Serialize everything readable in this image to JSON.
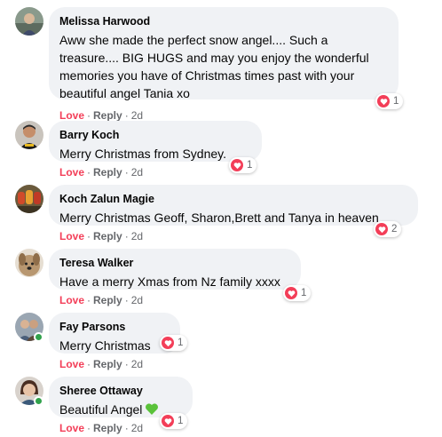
{
  "comments": [
    {
      "author": "Melissa Harwood",
      "lines": [
        "Aww she made the perfect snow angel.... Such a",
        "treasure.... BIG HUGS and may you enjoy the wonderful",
        "memories you have of Christmas times past with your",
        "beautiful angel Tania xo"
      ],
      "reaction_count": "1",
      "love_label": "Love",
      "reply_label": "Reply",
      "time": "2d",
      "avatar_icon": "profile-photo"
    },
    {
      "author": "Barry Koch",
      "text": "Merry Christmas from Sydney.",
      "reaction_count": "1",
      "love_label": "Love",
      "reply_label": "Reply",
      "time": "2d",
      "avatar_icon": "profile-photo"
    },
    {
      "author": "Koch Zalun Magie",
      "text": "Merry Christmas Geoff, Sharon,Brett and Tanya in heaven",
      "reaction_count": "2",
      "love_label": "Love",
      "reply_label": "Reply",
      "time": "2d",
      "avatar_icon": "profile-photo"
    },
    {
      "author": "Teresa Walker",
      "text": "Have a merry Xmas from Nz family xxxx",
      "reaction_count": "1",
      "love_label": "Love",
      "reply_label": "Reply",
      "time": "2d",
      "avatar_icon": "profile-photo"
    },
    {
      "author": "Fay Parsons",
      "text": "Merry Christmas",
      "reaction_count": "1",
      "love_label": "Love",
      "reply_label": "Reply",
      "time": "2d",
      "avatar_icon": "profile-photo",
      "online": true
    },
    {
      "author": "Sheree Ottaway",
      "text": "Beautiful Angel",
      "emoji": "green-heart-icon",
      "reaction_count": "1",
      "love_label": "Love",
      "reply_label": "Reply",
      "time": "2d",
      "avatar_icon": "profile-photo",
      "online": true
    }
  ],
  "separator": "·",
  "colors": {
    "bubble_bg": "#f0f2f5",
    "love_red": "#f33e58",
    "meta_gray": "#65676b",
    "online_green": "#31a24c"
  }
}
